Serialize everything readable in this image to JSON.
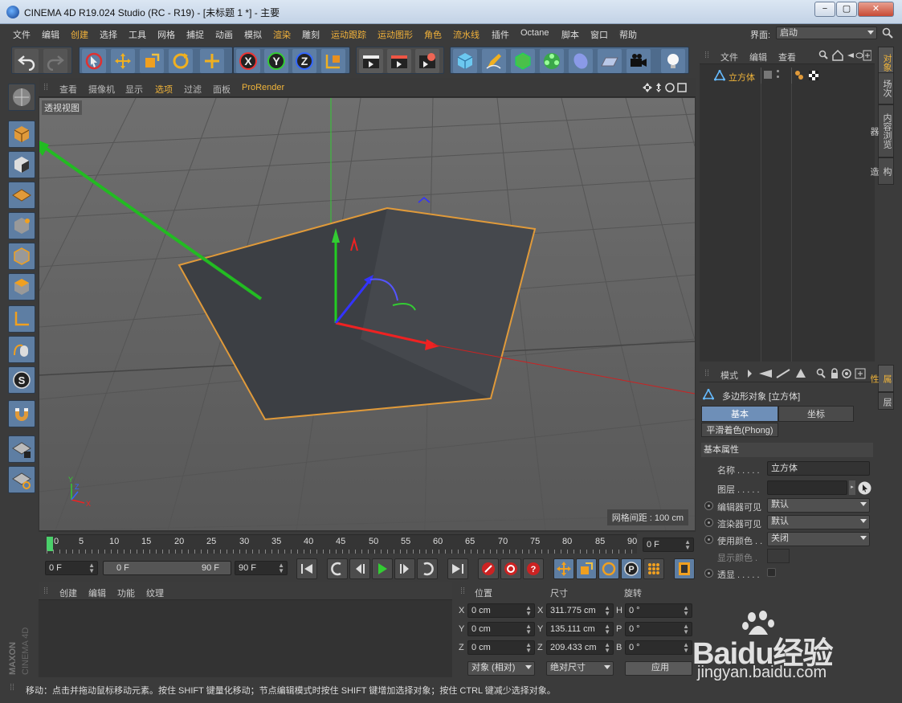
{
  "window": {
    "title": "CINEMA 4D R19.024 Studio (RC - R19) - [未标题 1 *] - 主要",
    "minimize": "−",
    "maximize": "▢",
    "close": "✕"
  },
  "menubar": {
    "items": [
      "文件",
      "编辑",
      "创建",
      "选择",
      "工具",
      "网格",
      "捕捉",
      "动画",
      "模拟",
      "渲染",
      "雕刻",
      "运动跟踪",
      "运动图形",
      "角色",
      "流水线",
      "插件",
      "Octane",
      "脚本",
      "窗口",
      "帮助"
    ],
    "layout_label": "界面:",
    "layout_value": "启动"
  },
  "toolbar": {
    "icons": [
      "undo-icon",
      "redo-icon",
      "live-select-icon",
      "move-icon",
      "scale-icon",
      "rotate-icon",
      "create-icon",
      "x-axis-icon",
      "y-axis-icon",
      "z-axis-icon",
      "coordinate-system-icon",
      "render-view-icon",
      "render-picture-viewer-icon",
      "render-settings-icon",
      "cube-icon",
      "pen-icon",
      "subdivision-icon",
      "cloner-icon",
      "deformer-icon",
      "floor-icon",
      "camera-icon",
      "light-icon"
    ],
    "axis_x": "X",
    "axis_y": "Y",
    "axis_z": "Z"
  },
  "viewport": {
    "menu": [
      "查看",
      "摄像机",
      "显示",
      "选项",
      "过滤",
      "面板",
      "ProRender"
    ],
    "view_name": "透视视图",
    "grid_spacing": "网格间距 : 100 cm",
    "axis_x": "X",
    "axis_y": "Y",
    "axis_z": "Z"
  },
  "timeline": {
    "ticks": [
      "0",
      "5",
      "10",
      "15",
      "20",
      "25",
      "30",
      "35",
      "40",
      "45",
      "50",
      "55",
      "60",
      "65",
      "70",
      "75",
      "80",
      "85",
      "90"
    ],
    "current_frame": "0 F"
  },
  "playback": {
    "start": "0 F",
    "range_start": "0 F",
    "range_end": "90 F",
    "end": "90 F"
  },
  "material_panel": {
    "menu": [
      "创建",
      "编辑",
      "功能",
      "纹理"
    ]
  },
  "coords": {
    "headers": [
      "位置",
      "尺寸",
      "旋转"
    ],
    "rows": [
      {
        "axis": "X",
        "pos": "0 cm",
        "size_axis": "X",
        "size": "311.775 cm",
        "rot_axis": "H",
        "rot": "0 °"
      },
      {
        "axis": "Y",
        "pos": "0 cm",
        "size_axis": "Y",
        "size": "135.111 cm",
        "rot_axis": "P",
        "rot": "0 °"
      },
      {
        "axis": "Z",
        "pos": "0 cm",
        "size_axis": "Z",
        "size": "209.433 cm",
        "rot_axis": "B",
        "rot": "0 °"
      }
    ],
    "mode": "对象 (相对)",
    "size_mode": "绝对尺寸",
    "apply": "应用"
  },
  "object_panel": {
    "menu": [
      "文件",
      "编辑",
      "查看"
    ],
    "object_name": "立方体"
  },
  "attributes": {
    "menu": "模式",
    "object_title": "多边形对象 [立方体]",
    "tabs": [
      "基本",
      "坐标"
    ],
    "phong_tab": "平滑着色(Phong)",
    "section": "基本属性",
    "rows": [
      {
        "label": "名称 . . . . .",
        "value": "立方体"
      },
      {
        "label": "图层 . . . . .",
        "value": ""
      },
      {
        "label": "编辑器可见",
        "value": "默认"
      },
      {
        "label": "渲染器可见",
        "value": "默认"
      },
      {
        "label": "使用颜色 . .",
        "value": "关闭"
      },
      {
        "label": "显示颜色 .",
        "value": ""
      },
      {
        "label": "透显 . . . . .",
        "value": ""
      }
    ]
  },
  "side_tabs": [
    "对象",
    "场次",
    "内容浏览器",
    "构造",
    "属性",
    "层"
  ],
  "status": "移动：点击并拖动鼠标移动元素。按住 SHIFT 键量化移动；节点编辑模式时按住 SHIFT 键增加选择对象；按住 CTRL 键减少选择对象。",
  "brand": {
    "maxon": "MAXON",
    "product": "CINEMA 4D"
  },
  "watermark": {
    "line1": "Baidu经验",
    "line2": "jingyan.baidu.com"
  }
}
